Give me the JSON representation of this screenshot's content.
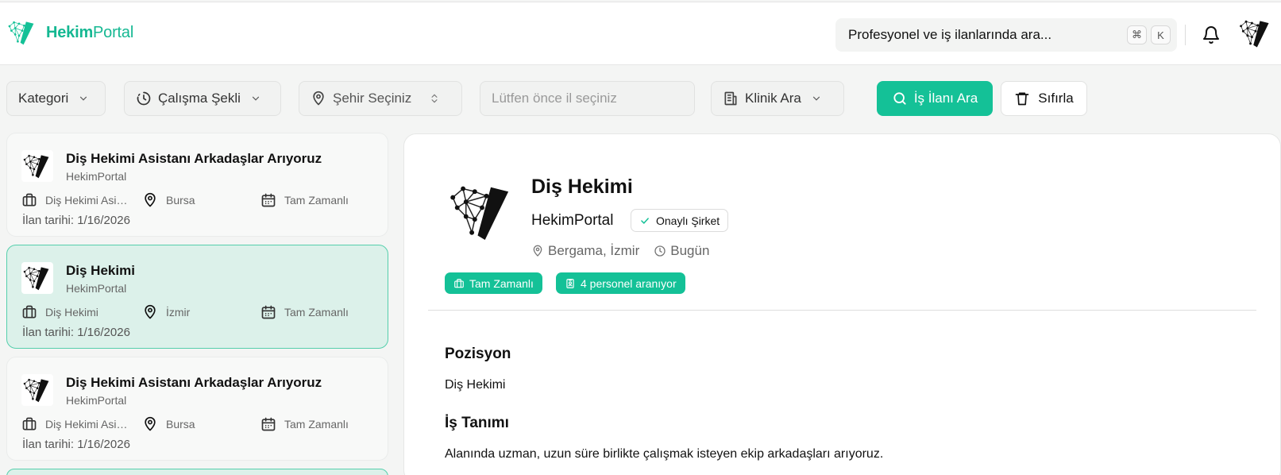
{
  "header": {
    "logo_bold": "Hekim",
    "logo_rest": "Portal",
    "search_placeholder": "Profesyonel ve iş ilanlarında ara...",
    "kbd_cmd": "⌘",
    "kbd_k": "K"
  },
  "filters": {
    "kategori": "Kategori",
    "calisma": "Çalışma Şekli",
    "sehir": "Şehir Seçiniz",
    "ilce_placeholder": "Lütfen önce il seçiniz",
    "klinik": "Klinik Ara",
    "search_button": "İş İlanı Ara",
    "reset_button": "Sıfırla"
  },
  "listings": [
    {
      "title": "Diş Hekimi Asistanı Arkadaşlar Arıyoruz",
      "company": "HekimPortal",
      "position": "Diş Hekimi Asistanı",
      "city": "Bursa",
      "type": "Tam Zamanlı",
      "date": "İlan tarihi: 1/16/2026"
    },
    {
      "title": "Diş Hekimi",
      "company": "HekimPortal",
      "position": "Diş Hekimi",
      "city": "İzmir",
      "type": "Tam Zamanlı",
      "date": "İlan tarihi: 1/16/2026"
    },
    {
      "title": "Diş Hekimi Asistanı Arkadaşlar Arıyoruz",
      "company": "HekimPortal",
      "position": "Diş Hekimi Asistanı",
      "city": "Bursa",
      "type": "Tam Zamanlı",
      "date": "İlan tarihi: 1/16/2026"
    }
  ],
  "detail": {
    "title": "Diş Hekimi",
    "company": "HekimPortal",
    "badge": "Onaylı Şirket",
    "location": "Bergama, İzmir",
    "posted": "Bugün",
    "tag_type": "Tam Zamanlı",
    "tag_count": "4 personel aranıyor",
    "pozisyon_heading": "Pozisyon",
    "pozisyon_text": "Diş Hekimi",
    "is_tanimi_heading": "İş Tanımı",
    "is_tanimi_text": "Alanında uzman, uzun süre birlikte çalışmak isteyen ekip arkadaşları arıyoruz."
  },
  "colors": {
    "brand": "#14c197",
    "active_card_bg": "#dcf1ea"
  }
}
